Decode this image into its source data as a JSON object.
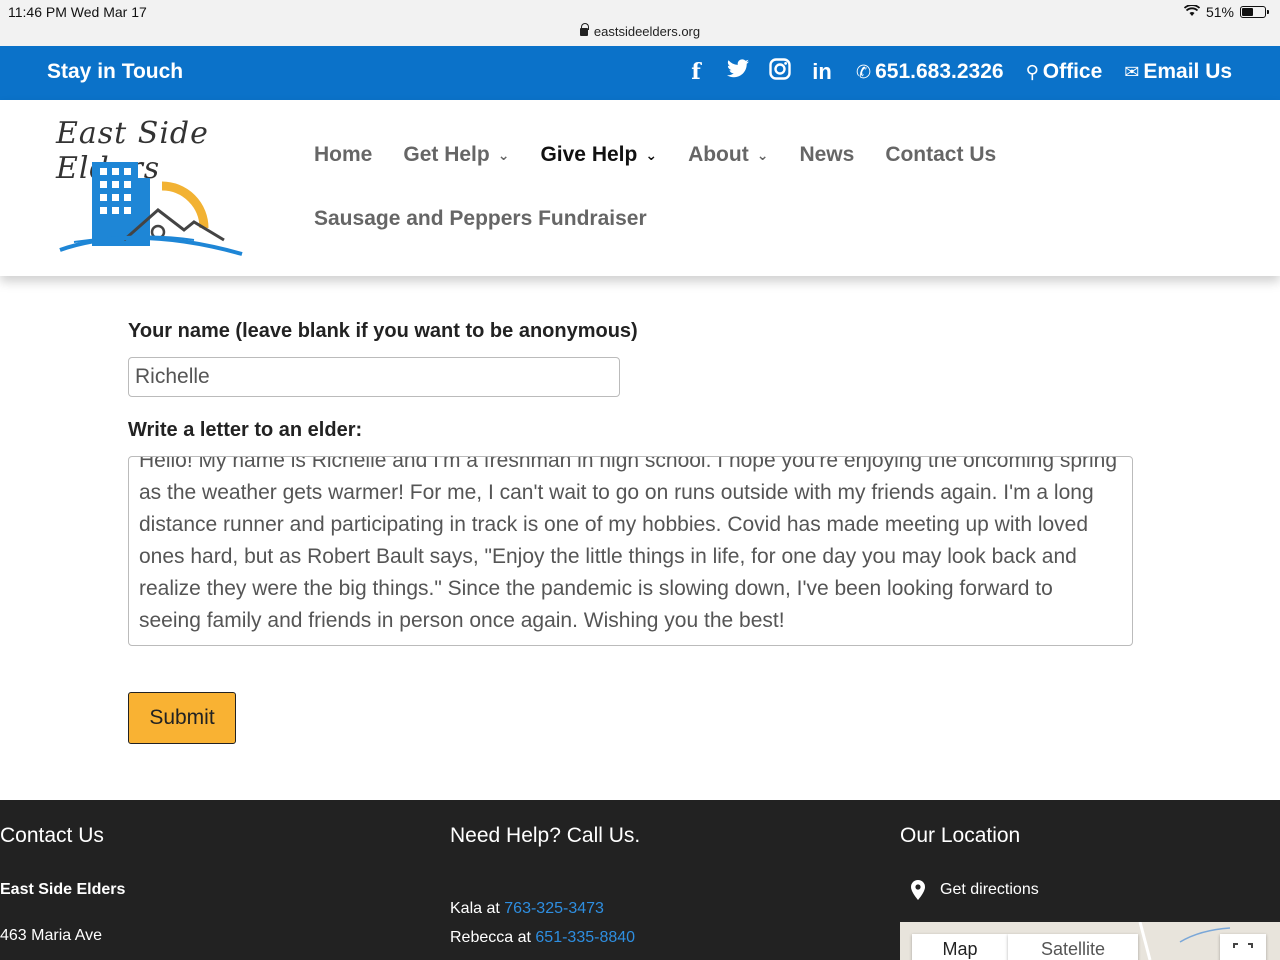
{
  "status_bar": {
    "time": "11:46 PM   Wed Mar 17",
    "url": "eastsideelders.org",
    "battery": "51%",
    "battery_level": 0.51
  },
  "top_bar": {
    "title": "Stay in Touch",
    "social": [
      "f",
      "t",
      "ig",
      "in"
    ],
    "phone": "651.683.2326",
    "office": "Office",
    "email": "Email Us"
  },
  "logo": {
    "text": "East Side Elders"
  },
  "nav": {
    "items": [
      {
        "label": "Home"
      },
      {
        "label": "Get Help"
      },
      {
        "label": "Give Help"
      },
      {
        "label": "About"
      },
      {
        "label": "News"
      },
      {
        "label": "Contact Us"
      },
      {
        "label": "Sausage and Peppers Fundraiser"
      }
    ]
  },
  "form": {
    "name_label": "Your name (leave blank if you want to be anonymous)",
    "name_value": "Richelle",
    "letter_label": "Write a letter to an elder:",
    "letter_value": "Hello! My name is Richelle and I'm a freshman in high school. I hope you're enjoying the oncoming spring as the weather gets warmer! For me, I can't wait to go on runs outside with my friends again. I'm a long distance runner and participating in track is one of my hobbies. Covid has made meeting up with loved ones hard, but as Robert Bault says, \"Enjoy the little things in life, for one day you may look back and realize they were the big things.\" Since the pandemic is slowing down, I've been looking forward to seeing family and friends in person once again. Wishing you the best!",
    "submit_label": "Submit"
  },
  "footer": {
    "contact_title": "Contact Us",
    "org_name": "East Side Elders",
    "address": "463 Maria Ave",
    "help_title": "Need Help?  Call Us.",
    "kala_prefix": "Kala at ",
    "kala_phone": "763-325-3473",
    "rebecca_prefix": "Rebecca at ",
    "rebecca_phone": "651-335-8840",
    "location_title": "Our Location",
    "directions": "Get directions",
    "map_tab": "Map",
    "satellite_tab": "Satellite"
  },
  "colors": {
    "brand_blue": "#0b72c9",
    "submit_yellow": "#f9b233",
    "footer_bg": "#222222"
  }
}
